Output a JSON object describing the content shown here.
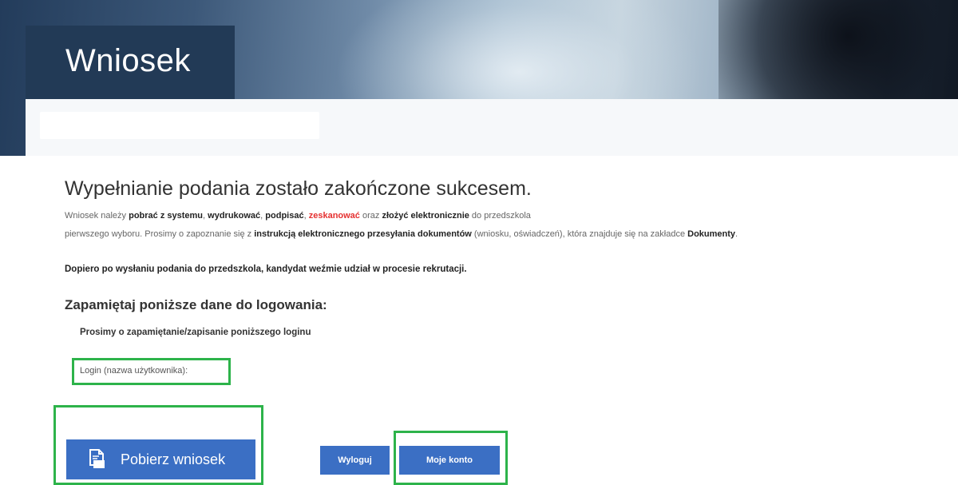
{
  "header": {
    "title": "Wniosek"
  },
  "message": {
    "heading": "Wypełnianie podania zostało zakończone sukcesem.",
    "p1": {
      "t1": "Wniosek należy ",
      "b1": "pobrać z systemu",
      "t2": ", ",
      "b2": "wydrukować",
      "t3": ", ",
      "b3": "podpisać",
      "t4": ", ",
      "red": "zeskanować",
      "t5": " oraz ",
      "b4": "złożyć elektronicznie",
      "t6": " do przedszkola"
    },
    "p2": {
      "t1": "pierwszego wyboru. Prosimy o zapoznanie się z ",
      "b1": "instrukcją elektronicznego przesyłania dokumentów",
      "t2": " (wniosku, oświadczeń), która znajduje się na zakładce ",
      "b2": "Dokumenty",
      "t3": "."
    },
    "notice": "Dopiero po wysłaniu podania do przedszkola, kandydat weźmie udział w procesie rekrutacji."
  },
  "login": {
    "heading": "Zapamiętaj poniższe dane do logowania:",
    "subheading": "Prosimy o zapamiętanie/zapisanie poniższego loginu",
    "field_label": "Login (nazwa użytkownika):"
  },
  "buttons": {
    "download": "Pobierz wniosek",
    "logout": "Wyloguj",
    "account": "Moje konto"
  },
  "colors": {
    "primary": "#3b6fc4",
    "highlight": "#2db34a",
    "title_bg": "#223a56",
    "warning": "#e53030"
  },
  "icons": {
    "download": "pdf-document-icon"
  }
}
